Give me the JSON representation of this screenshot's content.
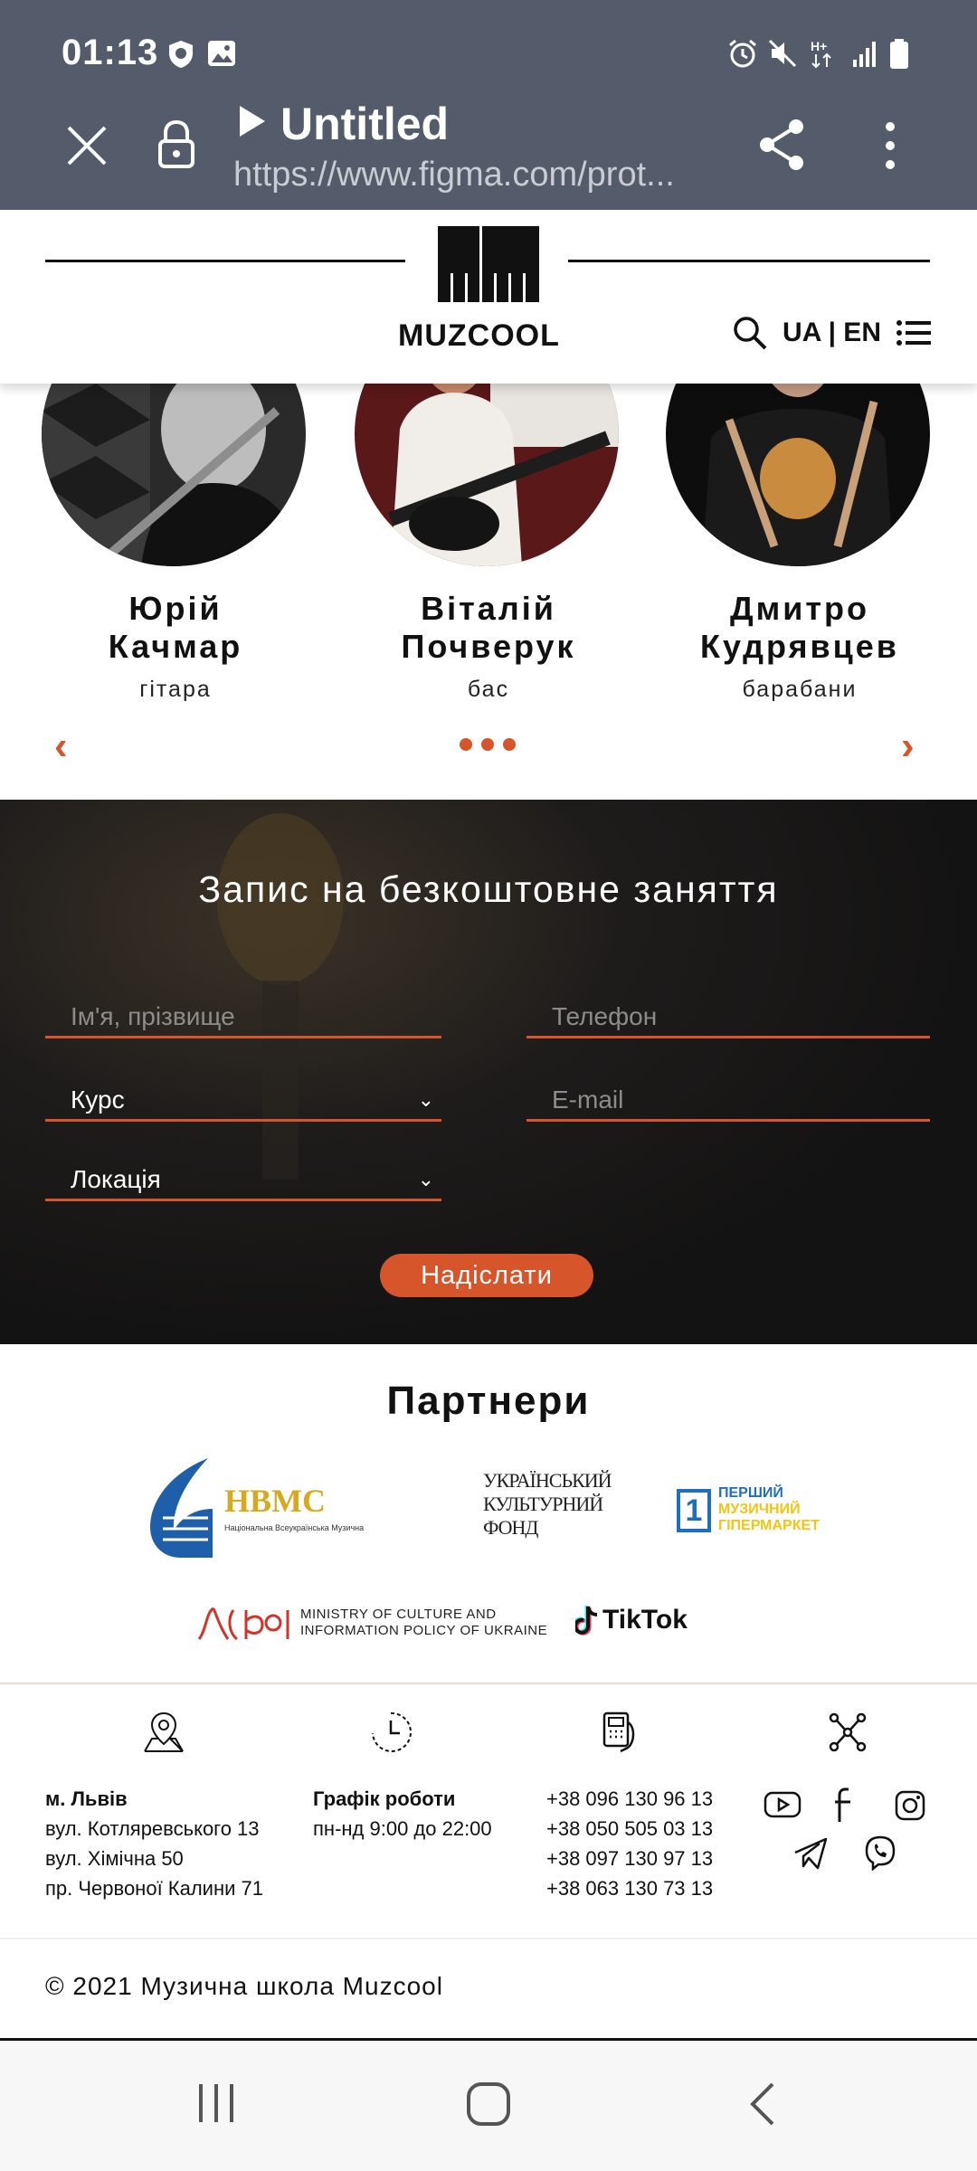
{
  "status_bar": {
    "time": "01:13"
  },
  "browser": {
    "title": "Untitled",
    "url": "https://www.figma.com/prot..."
  },
  "header": {
    "logo_text": "MUZCOOL",
    "lang_switch": "UA | EN"
  },
  "teachers": {
    "items": [
      {
        "name_line1": "Юрій",
        "name_line2": "Качмар",
        "instrument": "гітара"
      },
      {
        "name_line1": "Віталій",
        "name_line2": "Почверук",
        "instrument": "бас"
      },
      {
        "name_line1": "Дмитро",
        "name_line2": "Кудрявцев",
        "instrument": "барабани"
      }
    ],
    "prev": "‹",
    "next": "›"
  },
  "signup": {
    "title": "Запис на безкоштовне заняття",
    "name_placeholder": "Ім'я, прізвище",
    "phone_placeholder": "Телефон",
    "course_value": "Курс",
    "email_placeholder": "E-mail",
    "location_value": "Локація",
    "submit_label": "Надіслати"
  },
  "partners": {
    "title": "Партнери",
    "logos": {
      "nvms_abbr": "НВМС",
      "nvms_sub": "Національна Всеукраїнська Музична",
      "ucf_line1": "УКРАЇНСЬКИЙ",
      "ucf_line2": "КУЛЬТУРНИЙ",
      "ucf_line3": "ФОНД",
      "pmg_num": "1",
      "pmg_line1": "ПЕРШИЙ",
      "pmg_line2": "МУЗИЧНИЙ",
      "pmg_line3": "ГІПЕРМАРКЕТ",
      "mcip_line1": "MINISTRY OF CULTURE AND",
      "mcip_line2": "INFORMATION POLICY OF UKRAINE",
      "tiktok": "TikTok"
    }
  },
  "footer": {
    "address_city": "м. Львів",
    "address_lines": [
      "вул. Котляревського 13",
      "вул. Хімічна 50",
      "пр. Червоної Калини 71"
    ],
    "schedule_title": "Графік роботи",
    "schedule_value": "пн-нд 9:00 до 22:00",
    "phones": [
      "+38 096 130 96 13",
      "+38 050 505 03 13",
      "+38 097 130 97 13",
      "+38 063 130 73 13"
    ]
  },
  "copyright": "© 2021 Музична школа Muzcool",
  "colors": {
    "accent": "#d6552a",
    "browser_bar": "#545b6b"
  }
}
